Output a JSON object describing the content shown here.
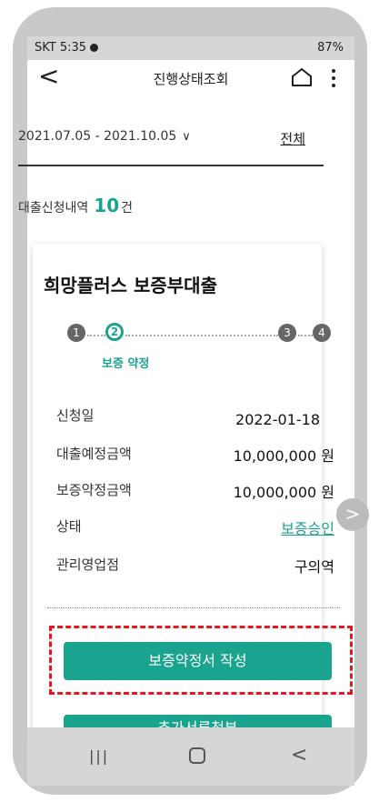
{
  "status_bar": {
    "carrier_time": "SKT 5:35",
    "signal_battery": "87%"
  },
  "header": {
    "title": "진행상태조회"
  },
  "filter": {
    "date_range": "2021.07.05 - 2021.10.05",
    "all_label": "전체"
  },
  "summary": {
    "label": "대출신청내역",
    "count": "10",
    "unit": "건"
  },
  "loan_card": {
    "title": "희망플러스 보증부대출",
    "steps": [
      {
        "number": "1",
        "state": "done"
      },
      {
        "number": "2",
        "state": "active",
        "label": "보증 약정"
      },
      {
        "number": "3",
        "state": "pending"
      },
      {
        "number": "4",
        "state": "pending"
      }
    ],
    "details": [
      {
        "label": "신청일",
        "value": "2022-01-18"
      },
      {
        "label": "대출예정금액",
        "value": "10,000,000 원"
      },
      {
        "label": "보증약정금액",
        "value": "10,000,000 원"
      },
      {
        "label": "상태",
        "value": "보증승인"
      },
      {
        "label": "관리영업점",
        "value": "구의역"
      }
    ],
    "primary_button": "보증약정서 작성",
    "secondary_button": "추가서류첨부"
  },
  "colors": {
    "accent": "#1aa38e",
    "highlight": "#e8171f"
  }
}
